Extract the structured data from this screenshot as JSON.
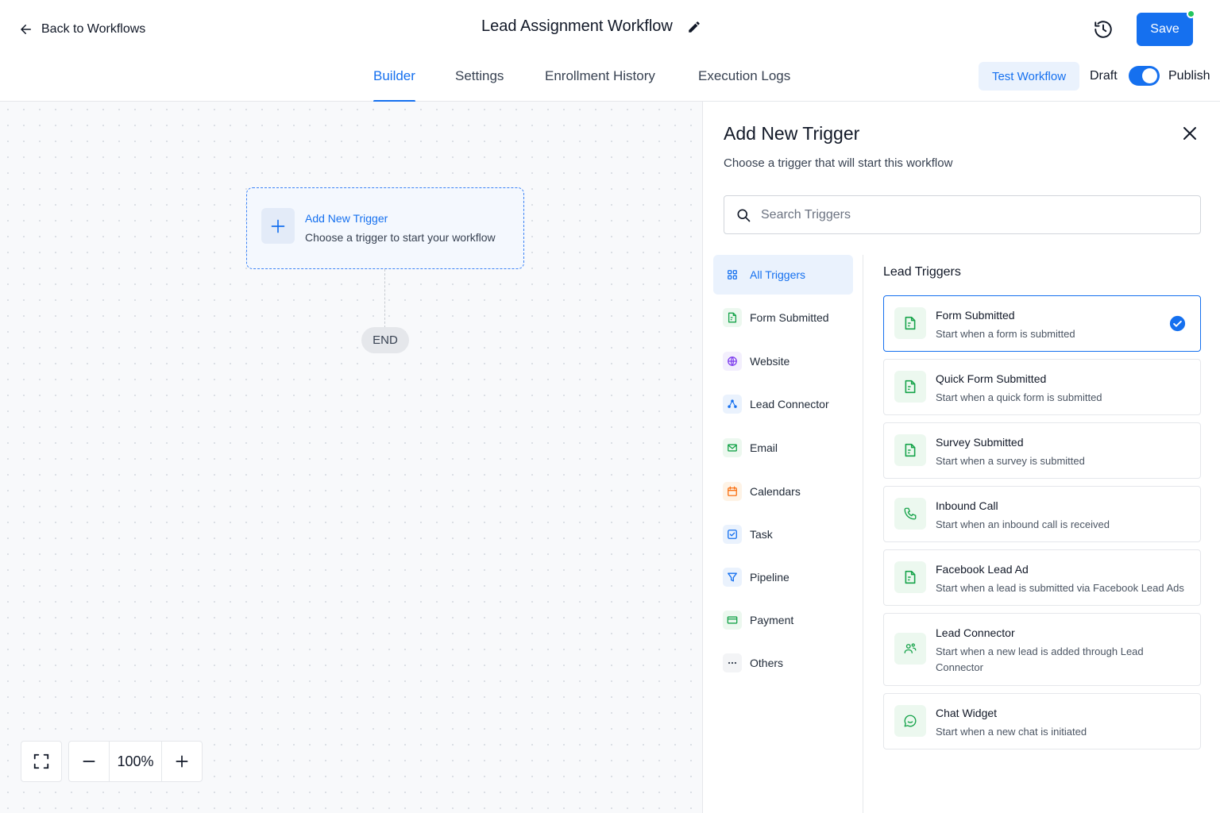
{
  "header": {
    "back_label": "Back to Workflows",
    "workflow_title": "Lead Assignment Workflow",
    "save_label": "Save"
  },
  "tabs": [
    {
      "label": "Builder",
      "active": true
    },
    {
      "label": "Settings",
      "active": false
    },
    {
      "label": "Enrollment History",
      "active": false
    },
    {
      "label": "Execution Logs",
      "active": false
    }
  ],
  "toolbar": {
    "test_label": "Test Workflow",
    "draft_label": "Draft",
    "publish_label": "Publish",
    "publish_enabled": true
  },
  "canvas": {
    "trigger_title": "Add New Trigger",
    "trigger_subtitle": "Choose a trigger to start your workflow",
    "end_label": "END",
    "zoom": "100%"
  },
  "panel": {
    "title": "Add New Trigger",
    "subtitle": "Choose a trigger that will start this workflow",
    "search_placeholder": "Search Triggers",
    "categories": [
      {
        "label": "All Triggers",
        "icon": "grid-icon",
        "active": true
      },
      {
        "label": "Form Submitted",
        "icon": "form-icon"
      },
      {
        "label": "Website",
        "icon": "globe-icon"
      },
      {
        "label": "Lead Connector",
        "icon": "connector-icon"
      },
      {
        "label": "Email",
        "icon": "mail-icon"
      },
      {
        "label": "Calendars",
        "icon": "calendar-icon"
      },
      {
        "label": "Task",
        "icon": "task-icon"
      },
      {
        "label": "Pipeline",
        "icon": "filter-icon"
      },
      {
        "label": "Payment",
        "icon": "card-icon"
      },
      {
        "label": "Others",
        "icon": "more-icon"
      }
    ],
    "list_heading": "Lead Triggers",
    "triggers": [
      {
        "title": "Form Submitted",
        "desc": "Start when a form is submitted",
        "icon": "form-icon",
        "selected": true
      },
      {
        "title": "Quick Form Submitted",
        "desc": "Start when a quick form is submitted",
        "icon": "form-icon"
      },
      {
        "title": "Survey Submitted",
        "desc": "Start when a survey is submitted",
        "icon": "form-icon"
      },
      {
        "title": "Inbound Call",
        "desc": "Start when an inbound call is received",
        "icon": "phone-icon"
      },
      {
        "title": "Facebook Lead Ad",
        "desc": "Start when a lead is submitted via Facebook Lead Ads",
        "icon": "form-icon"
      },
      {
        "title": "Lead Connector",
        "desc": "Start when a new lead is added through Lead Connector",
        "icon": "users-icon"
      },
      {
        "title": "Chat Widget",
        "desc": "Start when a new chat is initiated",
        "icon": "chat-icon"
      }
    ]
  },
  "colors": {
    "accent": "#1570ef",
    "accent_light": "#eaf2fd",
    "green_icon": "#16a34a",
    "green_bg": "#ecf8ef"
  }
}
